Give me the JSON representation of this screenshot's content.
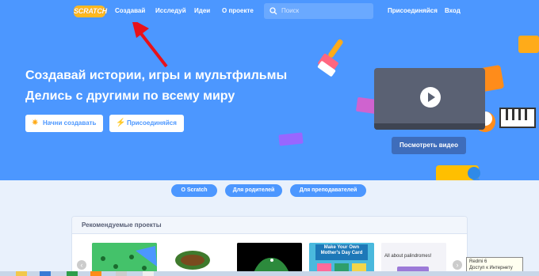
{
  "nav": {
    "logo": "SCRATCH",
    "items": [
      "Создавай",
      "Исследуй",
      "Идеи",
      "О проекте"
    ],
    "search_placeholder": "Поиск",
    "join": "Присоединяйся",
    "signin": "Вход"
  },
  "hero": {
    "title": "Создавай истории, игры и мультфильмы",
    "subtitle": "Делись с другими по всему миру",
    "start_btn": "Начни создавать",
    "join_btn": "Присоединяйся",
    "watch_video": "Посмотреть видео"
  },
  "links": [
    "О Scratch",
    "Для родителей",
    "Для преподавателей"
  ],
  "featured": {
    "title": "Рекомендуемые проекты",
    "cards": [
      {
        "label": ""
      },
      {
        "label": ""
      },
      {
        "label": ""
      },
      {
        "label": "Make Your Own Mother's Day Card"
      },
      {
        "label": "All about palindromes!"
      }
    ]
  },
  "tooltip": {
    "line1": "Redmi 6",
    "line2": "Доступ к Интернету"
  },
  "colors": {
    "brand_blue": "#4c97ff",
    "accent_yellow": "#ffab19",
    "annotation_red": "#e8121a"
  }
}
